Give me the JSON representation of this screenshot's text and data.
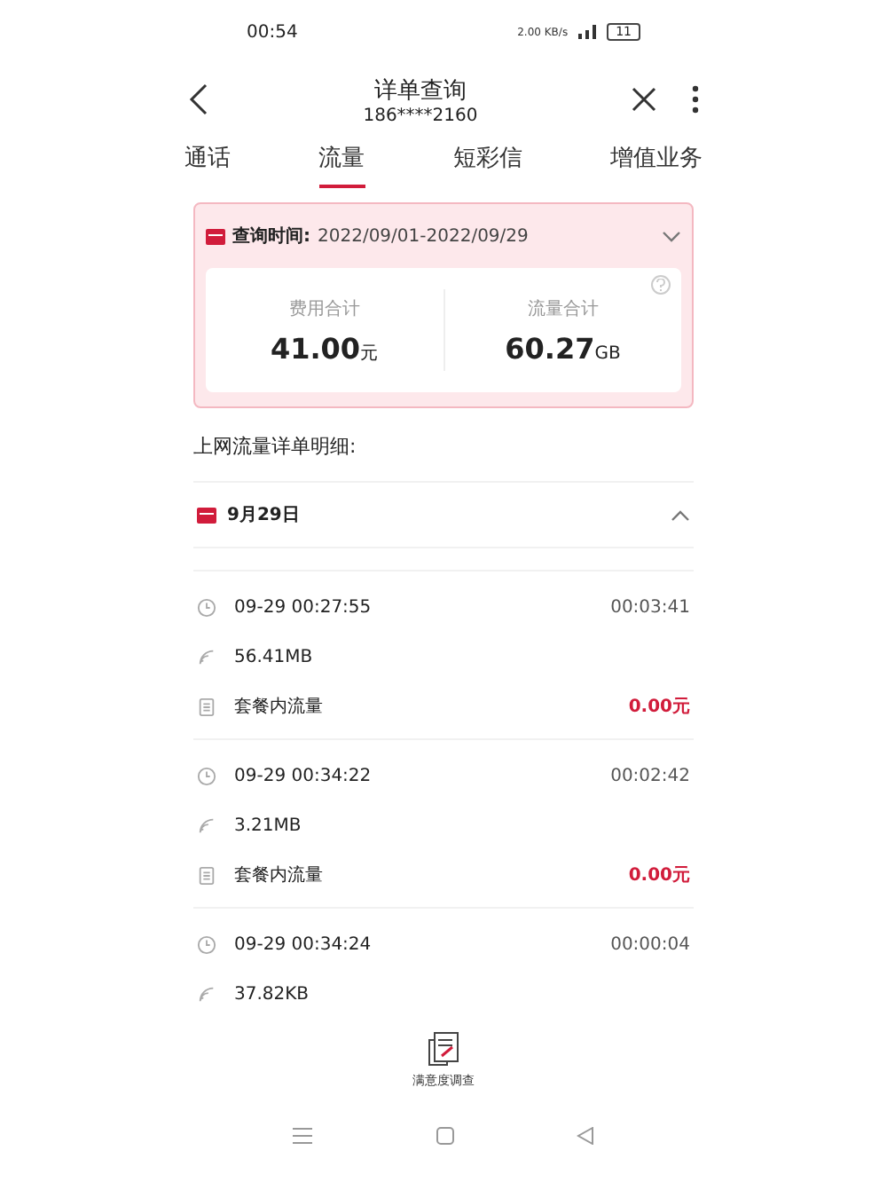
{
  "status_bar": {
    "time": "00:54",
    "speed": "2.00 KB/s",
    "battery": "11"
  },
  "header": {
    "title": "详单查询",
    "subtitle": "186****2160"
  },
  "tabs": [
    {
      "label": "通话",
      "selected": false
    },
    {
      "label": "流量",
      "selected": true
    },
    {
      "label": "短彩信",
      "selected": false
    },
    {
      "label": "增值业务",
      "selected": false
    }
  ],
  "summary": {
    "period_label": "查询时间:",
    "period": "2022/09/01-2022/09/29",
    "expanded": false,
    "stats": [
      {
        "label": "费用合计",
        "value": "41.00",
        "unit": "元"
      },
      {
        "label": "流量合计",
        "value": "60.27",
        "unit": "GB"
      }
    ]
  },
  "section_title": "上网流量详单明细:",
  "day": {
    "label": "9月29日",
    "expanded": true
  },
  "records": [
    {
      "time": "09-29 00:27:55",
      "duration": "00:03:41",
      "size": "56.41MB",
      "plan": "套餐内流量",
      "fee": "0.00元"
    },
    {
      "time": "09-29 00:34:22",
      "duration": "00:02:42",
      "size": "3.21MB",
      "plan": "套餐内流量",
      "fee": "0.00元"
    },
    {
      "time": "09-29 00:34:24",
      "duration": "00:00:04",
      "size": "37.82KB"
    }
  ],
  "survey": {
    "label": "满意度调查"
  }
}
